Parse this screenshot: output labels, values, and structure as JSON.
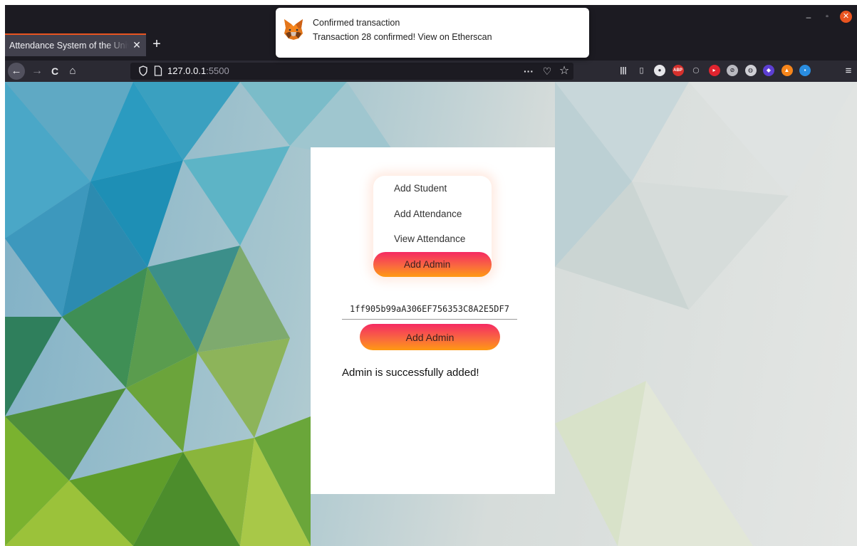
{
  "window": {
    "minimize_label": "–",
    "maximize_label": "▫",
    "close_label": "✕"
  },
  "tab": {
    "title": "Attendance System of the University",
    "close_label": "✕",
    "new_tab_label": "+"
  },
  "nav": {
    "back_label": "←",
    "forward_label": "→",
    "reload_label": "C",
    "home_label": "⌂",
    "url_host": "127.0.0.1",
    "url_port": ":5500",
    "more_label": "···",
    "pocket_label": "♡",
    "bookmark_label": "☆",
    "menu_label": "≡"
  },
  "toolbar_icons": [
    {
      "name": "library-icon",
      "glyph": "|||",
      "color": "#2b2a33",
      "fg": "#e6e6ea"
    },
    {
      "name": "sidebar-icon",
      "glyph": "▯",
      "color": "#2b2a33",
      "fg": "#e6e6ea"
    },
    {
      "name": "account-icon",
      "glyph": "●",
      "color": "#e6e6ea",
      "fg": "#2b2a33"
    },
    {
      "name": "adblock-icon",
      "glyph": "ABP",
      "color": "#d6302c",
      "fg": "#ffffff"
    },
    {
      "name": "extension-ring-icon",
      "glyph": "◯",
      "color": "#2b2a33",
      "fg": "#e6e6ea"
    },
    {
      "name": "extension-red-icon",
      "glyph": "▸",
      "color": "#e0242f",
      "fg": "#ffffff"
    },
    {
      "name": "extension-swirl-icon",
      "glyph": "⊘",
      "color": "#b9b9c0",
      "fg": "#2b2a33"
    },
    {
      "name": "extension-globe-icon",
      "glyph": "◍",
      "color": "#d0d0d6",
      "fg": "#2b2a33"
    },
    {
      "name": "extension-purple-icon",
      "glyph": "◆",
      "color": "#5d3fd3",
      "fg": "#ffffff"
    },
    {
      "name": "metamask-icon",
      "glyph": "▲",
      "color": "#f6851b",
      "fg": "#ffffff"
    },
    {
      "name": "extension-blue-icon",
      "glyph": "▪",
      "color": "#2a8de0",
      "fg": "#ffffff"
    }
  ],
  "notification": {
    "title": "Confirmed transaction",
    "body": "Transaction 28 confirmed! View on Etherscan"
  },
  "menu": {
    "items": [
      {
        "label": "Add Student"
      },
      {
        "label": "Add Attendance"
      },
      {
        "label": "View Attendance"
      },
      {
        "label": "Add Admin"
      }
    ],
    "active_index": 3
  },
  "form": {
    "address_value": "1ff905b99aA306EF756353C8A2E5DF7",
    "button_label": "Add Admin",
    "status_message": "Admin is successfully added!"
  },
  "colors": {
    "accent_top": "#f52a63",
    "accent_bottom": "#ff9a12",
    "tab_highlight": "#e95420"
  }
}
